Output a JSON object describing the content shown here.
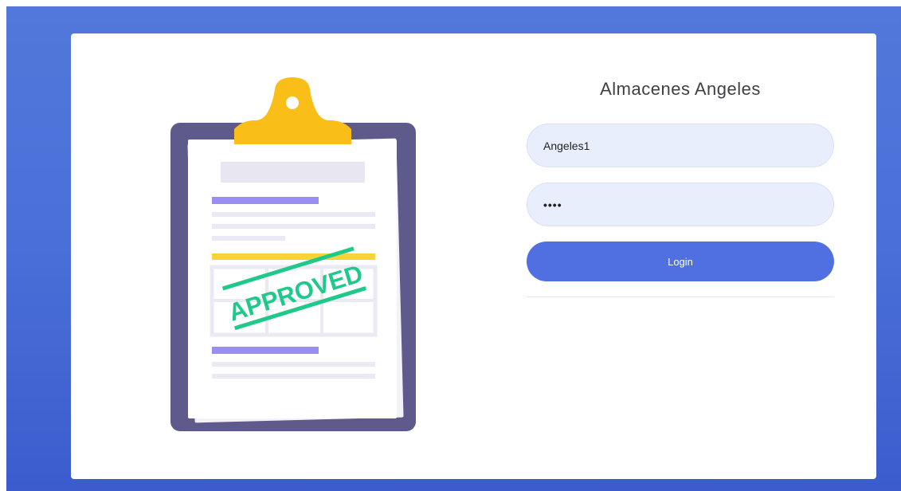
{
  "app": {
    "title": "Almacenes Angeles"
  },
  "login_form": {
    "username_value": "Angeles1",
    "password_value": "••••",
    "submit_label": "Login"
  },
  "illustration": {
    "stamp_text": "APPROVED"
  },
  "colors": {
    "background": "#4a6fd8",
    "button": "#5070e2",
    "input_background": "#e8eefc",
    "stamp": "#1fc98a",
    "clipboard": "#5e5a8b"
  }
}
